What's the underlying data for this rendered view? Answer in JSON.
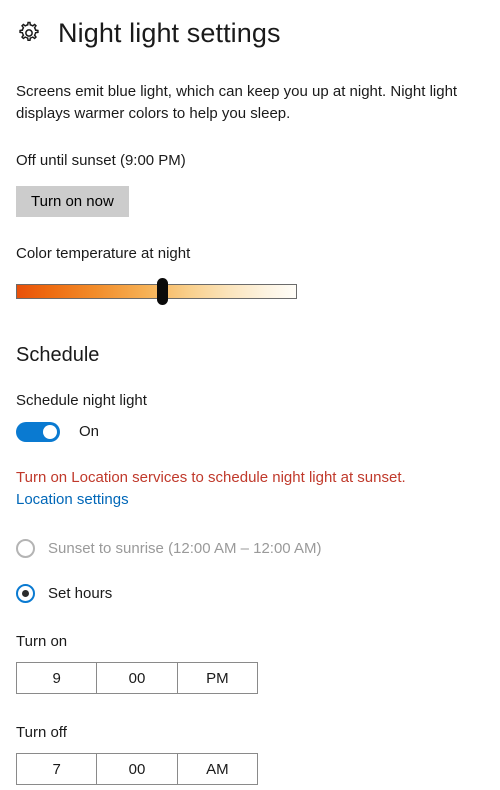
{
  "header": {
    "icon": "gear-icon",
    "title": "Night light settings"
  },
  "description": "Screens emit blue light, which can keep you up at night. Night light displays warmer colors to help you sleep.",
  "status": {
    "text": "Off until sunset (9:00 PM)",
    "button_label": "Turn on now"
  },
  "color_temperature": {
    "label": "Color temperature at night",
    "thumb_percent": 52,
    "gradient_start": "#e8500a",
    "gradient_end": "#fffdf8"
  },
  "schedule": {
    "heading": "Schedule",
    "toggle_label": "Schedule night light",
    "toggle_state": "On",
    "toggle_on": true,
    "accent_color": "#0a7ad1",
    "warning_text": "Turn on Location services to schedule night light at sunset.",
    "warning_color": "#c0392b",
    "link_text": "Location settings",
    "link_color": "#0067b8",
    "options": [
      {
        "label": "Sunset to sunrise (12:00 AM – 12:00 AM)",
        "selected": false,
        "disabled": true
      },
      {
        "label": "Set hours",
        "selected": true,
        "disabled": false
      }
    ],
    "turn_on": {
      "heading": "Turn on",
      "hour": "9",
      "minute": "00",
      "meridiem": "PM"
    },
    "turn_off": {
      "heading": "Turn off",
      "hour": "7",
      "minute": "00",
      "meridiem": "AM"
    }
  }
}
